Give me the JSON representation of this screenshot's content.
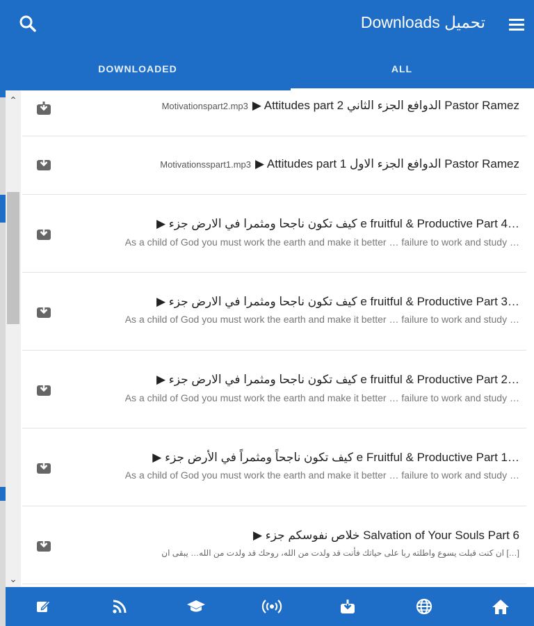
{
  "header": {
    "title": "Downloads تحميل",
    "search_icon": "search-icon",
    "menu_icon": "hamburger-menu-icon",
    "color": "#1e6ec8"
  },
  "tabs": [
    {
      "label": "DOWNLOADED",
      "active": false
    },
    {
      "label": "ALL",
      "active": true
    }
  ],
  "items": [
    {
      "title": "▶ Attitudes part 2 الدوافع الجزء الثاني Pastor Ramez",
      "file": "Motivationspart2.mp3",
      "desc": ""
    },
    {
      "title": "▶ Attitudes part 1 الدوافع الجزء الاول Pastor Ramez",
      "file": "Motivationsspart1.mp3",
      "desc": ""
    },
    {
      "title": "▶ كيف تكون ناجحا ومثمرا في الارض جزء e fruitful & Productive Part 4…",
      "file": "",
      "desc": "As a child of God you must work the earth and make it better … failure to work and study …"
    },
    {
      "title": "▶ كيف تكون ناجحا ومثمرا في الارض جزء e fruitful & Productive Part 3…",
      "file": "",
      "desc": "As a child of God you must work the earth and make it better … failure to work and study …"
    },
    {
      "title": "▶ كيف تكون ناجحا ومثمرا في الارض جزء e fruitful & Productive Part 2…",
      "file": "",
      "desc": "As a child of God you must work the earth and make it better … failure to work and study …"
    },
    {
      "title": "▶ كيف تكون ناجحاً ومثمراً في الأرض جزء e Fruitful & Productive Part 1…",
      "file": "",
      "desc": "As a child of God you must work the earth and make it better … failure to work and study …"
    },
    {
      "title": "▶ خلاص نفوسكم جزء Salvation of Your Souls Part 6",
      "file": "",
      "desc": "ان كنت قبلت يسوع واطلته ربا على حياتك فأنت قد ولدت من الله، روحك قد ولدت من الله… يبقى ان […]"
    }
  ],
  "bottom_nav": [
    {
      "icon": "edit-icon"
    },
    {
      "icon": "rss-icon"
    },
    {
      "icon": "graduation-cap-icon"
    },
    {
      "icon": "broadcast-icon"
    },
    {
      "icon": "download-icon"
    },
    {
      "icon": "globe-icon"
    },
    {
      "icon": "home-icon"
    }
  ]
}
